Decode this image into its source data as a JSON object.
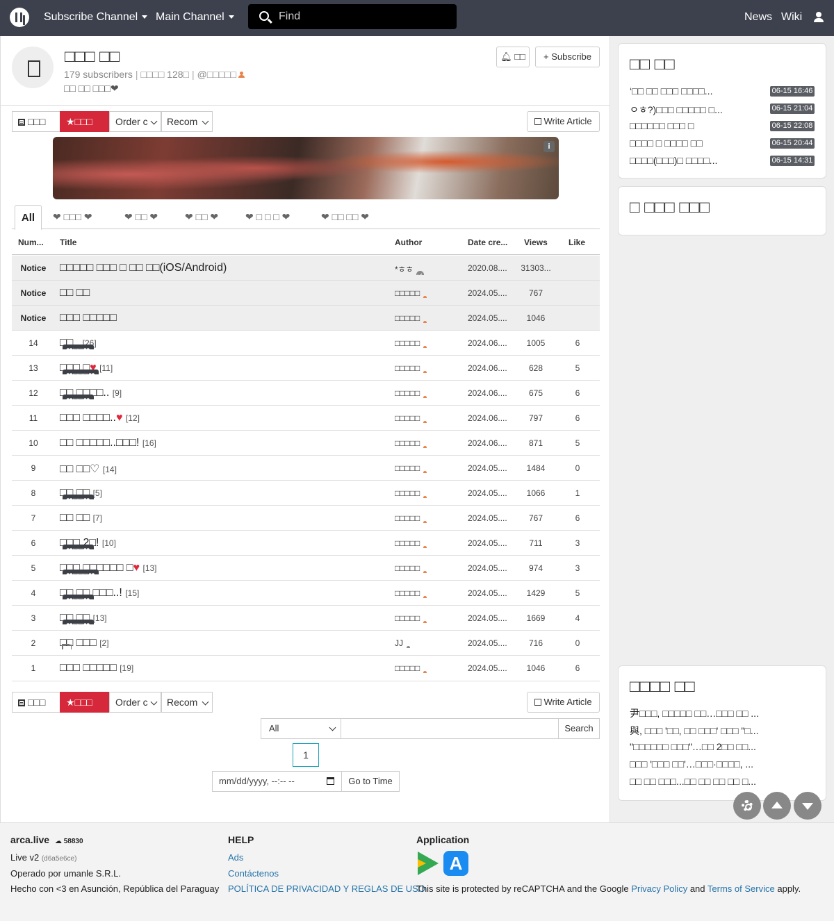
{
  "navbar": {
    "subscribe_channel": "Subscribe Channel",
    "main_channel": "Main Channel",
    "search_placeholder": "Find",
    "news": "News",
    "wiki": "Wiki"
  },
  "channel": {
    "title": "□□□ □□",
    "subscribers": "179 subscribers",
    "articles": "□□□□ 128□",
    "handle": "@□□□□□",
    "description": "□□ □□ □□□❤",
    "bell_label": "□□",
    "subscribe_label": "+ Subscribe"
  },
  "toolbar": {
    "all_label": "□□□",
    "best_label": "★□□□",
    "order_label": "Order c",
    "recom_label": "Recom",
    "write_label": "Write Article"
  },
  "banner": {
    "info": "i"
  },
  "tabs": [
    {
      "label": "All"
    },
    {
      "label": "❤ □□□ ❤"
    },
    {
      "label": "❤ □□ ❤"
    },
    {
      "label": "❤ □□ ❤"
    },
    {
      "label": "❤ □ □ □ ❤"
    },
    {
      "label": "❤ □□ □□ ❤"
    }
  ],
  "table": {
    "headers": [
      "Num...",
      "Title",
      "Author",
      "Date cre...",
      "Views",
      "Like"
    ],
    "rows": [
      {
        "num": "Notice",
        "badge": "",
        "title": "□□□□□ □□□ □ □□ □□(iOS/Android)",
        "heart": "",
        "count": "",
        "author": "*ㅎㅎ",
        "author_type": "verified",
        "date": "2020.08....",
        "views": "31303...",
        "like": ""
      },
      {
        "num": "Notice",
        "badge": "",
        "title": "□□ □□",
        "heart": "",
        "count": "",
        "author": "□□□□□",
        "author_type": "user",
        "date": "2024.05....",
        "views": "767",
        "like": ""
      },
      {
        "num": "Notice",
        "badge": "",
        "title": "□□□ □□□□□",
        "heart": "",
        "count": "",
        "author": "□□□□□",
        "author_type": "user",
        "date": "2024.05....",
        "views": "1046",
        "like": ""
      },
      {
        "num": "14",
        "badge": "❤□□❤",
        "title": "□□..",
        "heart": "",
        "count": "[26]",
        "author": "□□□□□",
        "author_type": "user",
        "date": "2024.06....",
        "views": "1005",
        "like": "6"
      },
      {
        "num": "13",
        "badge": "❤□□□❤",
        "title": "□□□ □",
        "heart": "♥",
        "count": "[11]",
        "author": "□□□□□",
        "author_type": "user",
        "date": "2024.06....",
        "views": "628",
        "like": "5"
      },
      {
        "num": "12",
        "badge": "❤□□❤",
        "title": "□□ □□□□..",
        "heart": "",
        "count": "[9]",
        "author": "□□□□□",
        "author_type": "user",
        "date": "2024.06....",
        "views": "675",
        "like": "6"
      },
      {
        "num": "11",
        "badge": "",
        "title": "□□□ □□□□..",
        "heart": "♥",
        "count": "[12]",
        "author": "□□□□□",
        "author_type": "user",
        "date": "2024.06....",
        "views": "797",
        "like": "6"
      },
      {
        "num": "10",
        "badge": "",
        "title": "□□ □□□□□..□□□!",
        "heart": "",
        "count": "[16]",
        "author": "□□□□□",
        "author_type": "user",
        "date": "2024.06....",
        "views": "871",
        "like": "5"
      },
      {
        "num": "9",
        "badge": "",
        "title": "□□ □□♡",
        "heart": "",
        "count": "[14]",
        "author": "□□□□□",
        "author_type": "user",
        "date": "2024.05....",
        "views": "1484",
        "like": "0"
      },
      {
        "num": "8",
        "badge": "❤□□❤",
        "title": "□□ □□",
        "heart": "",
        "count": "[5]",
        "author": "□□□□□",
        "author_type": "user",
        "date": "2024.05....",
        "views": "1066",
        "like": "1"
      },
      {
        "num": "7",
        "badge": "",
        "title": "□□ □□",
        "heart": "",
        "count": "[7]",
        "author": "□□□□□",
        "author_type": "user",
        "date": "2024.05....",
        "views": "767",
        "like": "6"
      },
      {
        "num": "6",
        "badge": "❤□□❤",
        "title": "□□□ 2□!",
        "heart": "",
        "count": "[10]",
        "author": "□□□□□",
        "author_type": "user",
        "date": "2024.05....",
        "views": "711",
        "like": "3"
      },
      {
        "num": "5",
        "badge": "❤□□□❤",
        "title": "□□□ □□□□□□ □",
        "heart": "♥",
        "count": "[13]",
        "author": "□□□□□",
        "author_type": "user",
        "date": "2024.05....",
        "views": "974",
        "like": "3"
      },
      {
        "num": "4",
        "badge": "❤□□❤",
        "title": "□□ □□ □□□..!",
        "heart": "",
        "count": "[15]",
        "author": "□□□□□",
        "author_type": "user",
        "date": "2024.05....",
        "views": "1429",
        "like": "5"
      },
      {
        "num": "3",
        "badge": "❤□□❤",
        "title": "□□ □□",
        "heart": "",
        "count": "[13]",
        "author": "□□□□□",
        "author_type": "user",
        "date": "2024.05....",
        "views": "1669",
        "like": "4"
      },
      {
        "num": "2",
        "badge": "",
        "title": "□□ □□□",
        "heart": "",
        "count": "[2]",
        "author": "JJ",
        "author_type": "gray",
        "date": "2024.05....",
        "views": "716",
        "like": "0",
        "gallery": true
      },
      {
        "num": "1",
        "badge": "",
        "title": "□□□ □□□□□",
        "heart": "",
        "count": "[19]",
        "author": "□□□□□",
        "author_type": "user",
        "date": "2024.05....",
        "views": "1046",
        "like": "6"
      }
    ]
  },
  "bottom": {
    "search_select": "All",
    "search_button": "Search",
    "page": "1",
    "date_placeholder": "mm/dd/yyyy, --:-- --",
    "goto_button": "Go to Time"
  },
  "sidebar": {
    "card1": {
      "title": "□□ □□",
      "items": [
        {
          "text": "‘□□ □□ □□□ □□□□...",
          "time": "06-15 16:46"
        },
        {
          "text": "ㅇㅎ?)□□□ □□□□□ □...",
          "time": "06-15 21:04"
        },
        {
          "text": "□□□□□□ □□□ □",
          "time": "06-15 22:08"
        },
        {
          "text": "□□□□ □ □□□□ □□",
          "time": "06-15 20:44"
        },
        {
          "text": "□□□□(□□□)□ □□□□...",
          "time": "06-15 14:31"
        }
      ]
    },
    "card2": {
      "title": "□ □□□ □□□"
    },
    "card3": {
      "title": "□□□□ □□",
      "items": [
        "尹□□□, □□□□□ □□…□□□ □□ ...",
        "與, □□□ '□□, □□ □□□' □□□ \"□...",
        "\"□□□□□□ □□□\"…□□ 2□□ □□...",
        "□□□ '□□□ □□'…□□□·□□□□, ...",
        "□□ □□ □□□...□□ □□ □□ □□ □..."
      ]
    }
  },
  "footer": {
    "site": "arca.live",
    "count": "58830",
    "version": "Live v2",
    "version_hash": "(d6a5e6ce)",
    "operated": "Operado por umanle S.R.L.",
    "made": "Hecho con <3 en Asunción, República del Paraguay",
    "help_title": "HELP",
    "ads": "Ads",
    "contact": "Contáctenos",
    "policy": "POLÍTICA DE PRIVACIDAD Y REGLAS DE USO",
    "app_title": "Application",
    "recaptcha_pre": "This site is protected by reCAPTCHA and the Google",
    "privacy": "Privacy Policy",
    "and": "and",
    "terms": "Terms of Service",
    "apply": "apply."
  }
}
